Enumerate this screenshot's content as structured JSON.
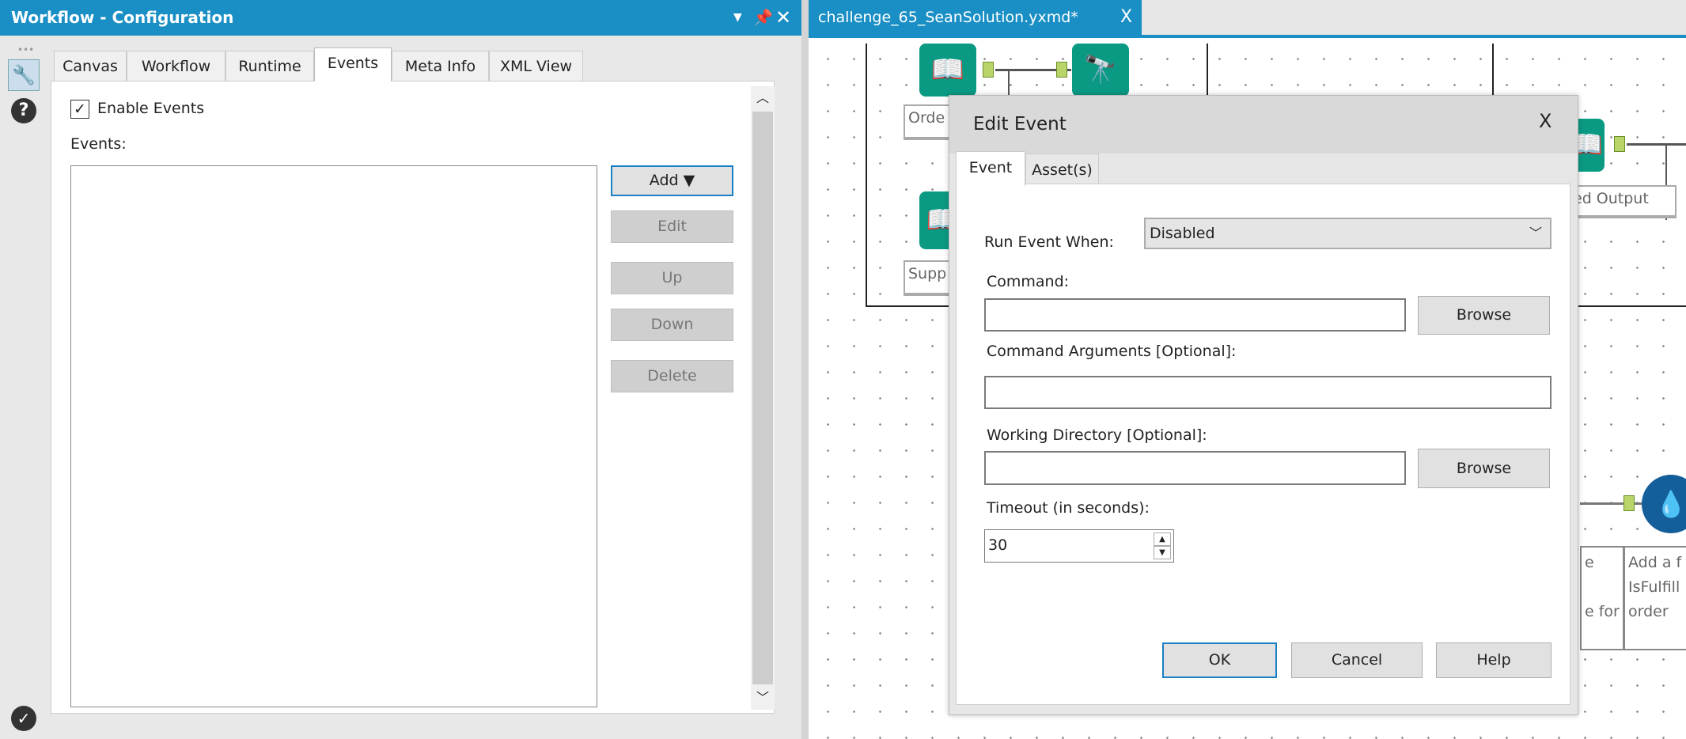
{
  "left_panel": {
    "title": "Workflow - Configuration",
    "title_icons": [
      "dropdown-icon",
      "pin-icon",
      "close-icon"
    ],
    "tabs": [
      {
        "label": "Canvas"
      },
      {
        "label": "Workflow"
      },
      {
        "label": "Runtime"
      },
      {
        "label": "Events",
        "active": true
      },
      {
        "label": "Meta Info"
      },
      {
        "label": "XML View"
      }
    ],
    "enable_events_label": "Enable Events",
    "enable_events_checked": true,
    "events_label": "Events:",
    "events_list": [],
    "buttons": {
      "add": "Add ▼",
      "edit": "Edit",
      "up": "Up",
      "down": "Down",
      "delete": "Delete"
    }
  },
  "document_tab": {
    "label": "challenge_65_SeanSolution.yxmd*",
    "close": "X"
  },
  "canvas": {
    "labels": [
      "Orde",
      "Supp",
      "ed Output",
      "e",
      "e for",
      "Add a f",
      "IsFulfill",
      "order"
    ]
  },
  "dialog": {
    "title": "Edit Event",
    "close": "X",
    "tabs": [
      {
        "label": "Event",
        "active": true
      },
      {
        "label": "Asset(s)"
      }
    ],
    "run_event_when_label": "Run Event When:",
    "run_event_when_value": "Disabled",
    "command_label": "Command:",
    "command_value": "",
    "browse": "Browse",
    "args_label": "Command Arguments [Optional]:",
    "args_value": "",
    "workdir_label": "Working Directory [Optional]:",
    "workdir_value": "",
    "timeout_label": "Timeout (in seconds):",
    "timeout_value": "30",
    "ok": "OK",
    "cancel": "Cancel",
    "help": "Help"
  },
  "colors": {
    "accent": "#1a8fc5",
    "tool_green": "#0a9a84",
    "tool_blue": "#145e99"
  }
}
